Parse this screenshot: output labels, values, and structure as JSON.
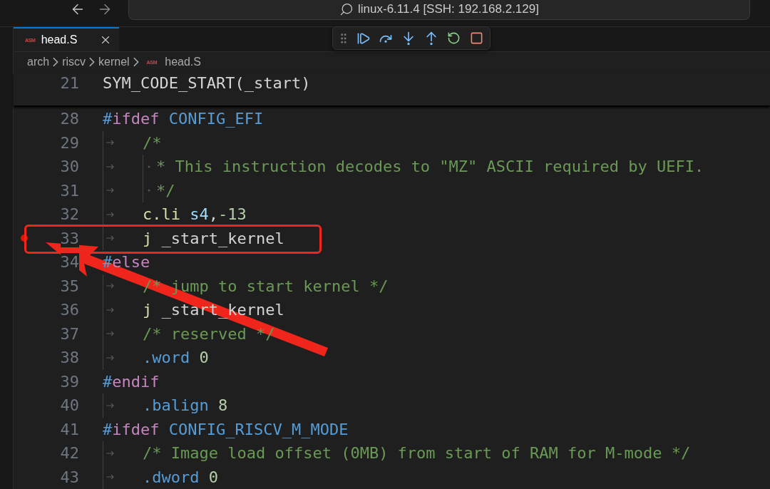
{
  "title_bar": {
    "search_text": "linux-6.11.4 [SSH: 192.168.2.129]"
  },
  "tabs": [
    {
      "label": "head.S",
      "icon_text": "ASM",
      "selected": true
    }
  ],
  "breadcrumbs": [
    {
      "label": "arch"
    },
    {
      "label": "riscv"
    },
    {
      "label": "kernel"
    },
    {
      "label": "head.S",
      "icon_text": "ASM"
    }
  ],
  "sticky_lines": [
    {
      "number": "21",
      "indented": false,
      "tokens": [
        {
          "text": "SYM_CODE_START(_start)",
          "kind": "plain"
        }
      ]
    }
  ],
  "lines": [
    {
      "number": "28",
      "indented": false,
      "tokens": [
        {
          "text": "#",
          "kind": "hash"
        },
        {
          "text": "ifdef",
          "kind": "preproc"
        },
        {
          "text": " CONFIG_EFI",
          "kind": "macro"
        }
      ]
    },
    {
      "number": "29",
      "indented": true,
      "tokens": [
        {
          "text": "/*",
          "kind": "comment"
        }
      ]
    },
    {
      "number": "30",
      "indented": true,
      "continuation": true,
      "tokens": [
        {
          "text": "* This instruction decodes to \"MZ\" ASCII required by UEFI.",
          "kind": "comment"
        }
      ]
    },
    {
      "number": "31",
      "indented": true,
      "continuation": true,
      "tokens": [
        {
          "text": "*/",
          "kind": "comment"
        }
      ]
    },
    {
      "number": "32",
      "indented": true,
      "tokens": [
        {
          "text": "c.li",
          "kind": "func"
        },
        {
          "text": " s4",
          "kind": "register"
        },
        {
          "text": ",",
          "kind": "plain"
        },
        {
          "text": "-13",
          "kind": "number"
        }
      ]
    },
    {
      "number": "33",
      "indented": true,
      "breakpoint": true,
      "highlighted": true,
      "tokens": [
        {
          "text": "j",
          "kind": "func"
        },
        {
          "text": " _start_kernel",
          "kind": "plain"
        }
      ]
    },
    {
      "number": "34",
      "indented": false,
      "tokens": [
        {
          "text": "#",
          "kind": "hash"
        },
        {
          "text": "else",
          "kind": "preproc"
        }
      ]
    },
    {
      "number": "35",
      "indented": true,
      "tokens": [
        {
          "text": "/* jump to start kernel */",
          "kind": "comment"
        }
      ]
    },
    {
      "number": "36",
      "indented": true,
      "tokens": [
        {
          "text": "j",
          "kind": "func"
        },
        {
          "text": " _start_kernel",
          "kind": "plain"
        }
      ]
    },
    {
      "number": "37",
      "indented": true,
      "tokens": [
        {
          "text": "/* reserved */",
          "kind": "comment"
        }
      ]
    },
    {
      "number": "38",
      "indented": true,
      "tokens": [
        {
          "text": ".word",
          "kind": "directive"
        },
        {
          "text": " 0",
          "kind": "number"
        }
      ]
    },
    {
      "number": "39",
      "indented": false,
      "tokens": [
        {
          "text": "#",
          "kind": "hash"
        },
        {
          "text": "endif",
          "kind": "preproc"
        }
      ]
    },
    {
      "number": "40",
      "indented": true,
      "tokens": [
        {
          "text": ".balign",
          "kind": "directive"
        },
        {
          "text": " 8",
          "kind": "number"
        }
      ]
    },
    {
      "number": "41",
      "indented": false,
      "tokens": [
        {
          "text": "#",
          "kind": "hash"
        },
        {
          "text": "ifdef",
          "kind": "preproc"
        },
        {
          "text": " CONFIG_RISCV_M_MODE",
          "kind": "macro"
        }
      ]
    },
    {
      "number": "42",
      "indented": true,
      "tokens": [
        {
          "text": "/* Image load offset (0MB) from start of RAM for M-mode */",
          "kind": "comment"
        }
      ]
    },
    {
      "number": "43",
      "indented": true,
      "tokens": [
        {
          "text": ".dword",
          "kind": "directive"
        },
        {
          "text": " 0",
          "kind": "number"
        }
      ]
    }
  ]
}
